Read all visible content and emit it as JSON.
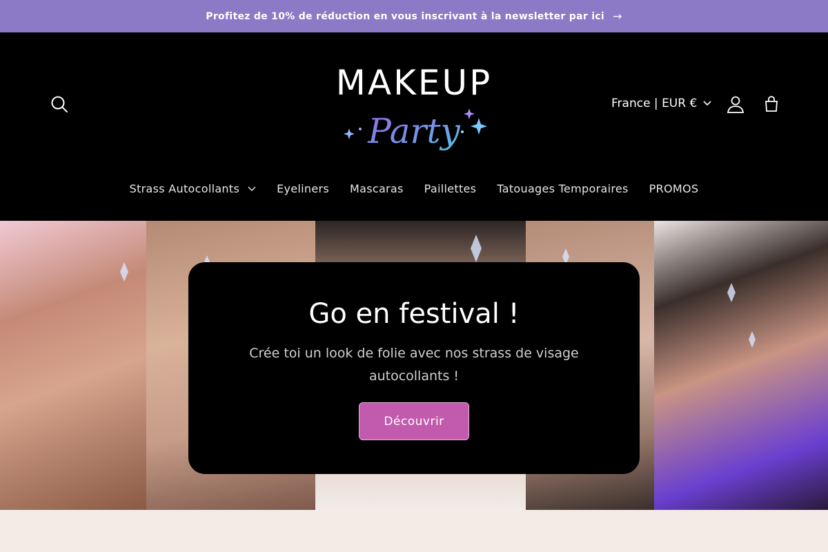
{
  "announcement": {
    "text": "Profitez de 10% de réduction en vous inscrivant à la newsletter par ici",
    "arrow_icon": "arrow-right-icon"
  },
  "header": {
    "logo": {
      "word": "MAKEUP",
      "script": "Party"
    },
    "locale": "France | EUR €",
    "icons": [
      "search-icon",
      "account-icon",
      "cart-icon",
      "chevron-down-icon"
    ]
  },
  "nav": {
    "items": [
      {
        "label": "Strass Autocollants",
        "has_dropdown": true
      },
      {
        "label": "Eyeliners"
      },
      {
        "label": "Mascaras"
      },
      {
        "label": "Paillettes"
      },
      {
        "label": "Tatouages Temporaires"
      },
      {
        "label": "PROMOS"
      }
    ]
  },
  "hero": {
    "title": "Go en festival !",
    "subtitle": "Crée toi un look de folie avec nos strass de visage autocollants !",
    "button_label": "Découvrir"
  },
  "colors": {
    "announcement_bg": "#8c7ac6",
    "header_bg": "#000000",
    "button_bg": "#c25aad",
    "footer_bg": "#f2ebe6"
  }
}
